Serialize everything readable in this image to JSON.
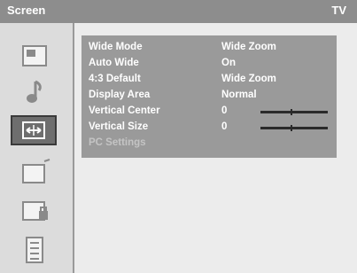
{
  "header": {
    "title": "Screen",
    "source": "TV"
  },
  "sidebar": {
    "icons": [
      "picture-icon",
      "sound-icon",
      "screen-adjust-icon",
      "feature-icon",
      "lock-icon",
      "list-icon"
    ],
    "selected_index": 2
  },
  "menu": {
    "rows": [
      {
        "label": "Wide Mode",
        "value": "Wide Zoom"
      },
      {
        "label": "Auto Wide",
        "value": "On"
      },
      {
        "label": "4:3 Default",
        "value": "Wide Zoom"
      },
      {
        "label": "Display Area",
        "value": "Normal"
      },
      {
        "label": "Vertical Center",
        "value": "0",
        "slider": 0.5
      },
      {
        "label": "Vertical Size",
        "value": "0",
        "slider": 0.5
      },
      {
        "label": "PC Settings",
        "value": "",
        "disabled": true
      }
    ]
  }
}
